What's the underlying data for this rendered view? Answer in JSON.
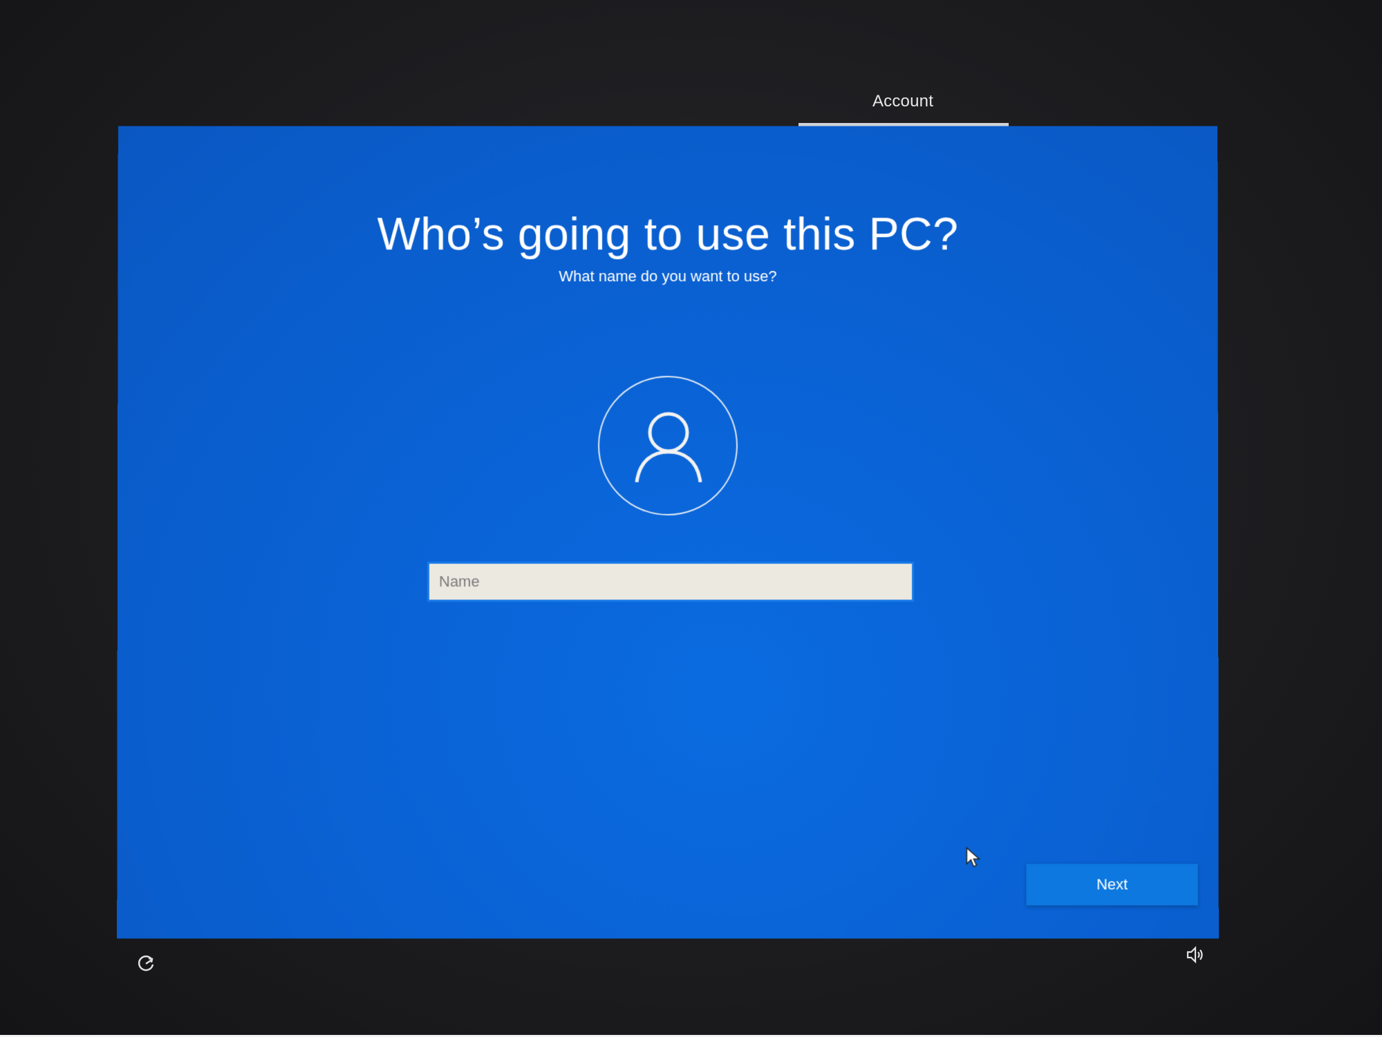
{
  "header": {
    "step_label": "Account"
  },
  "main": {
    "title": "Who’s going to use this PC?",
    "subtitle": "What name do you want to use?",
    "avatar_icon": "user-icon",
    "name_input": {
      "placeholder": "Name",
      "value": ""
    },
    "next_label": "Next"
  },
  "footer": {
    "left_icon": "ease-of-access-icon",
    "right_icon": "volume-icon"
  },
  "colors": {
    "screen_blue": "#0a62d4",
    "button_blue": "#0c78e0",
    "input_border": "#1a7be8",
    "input_fill": "#ece9e1"
  }
}
